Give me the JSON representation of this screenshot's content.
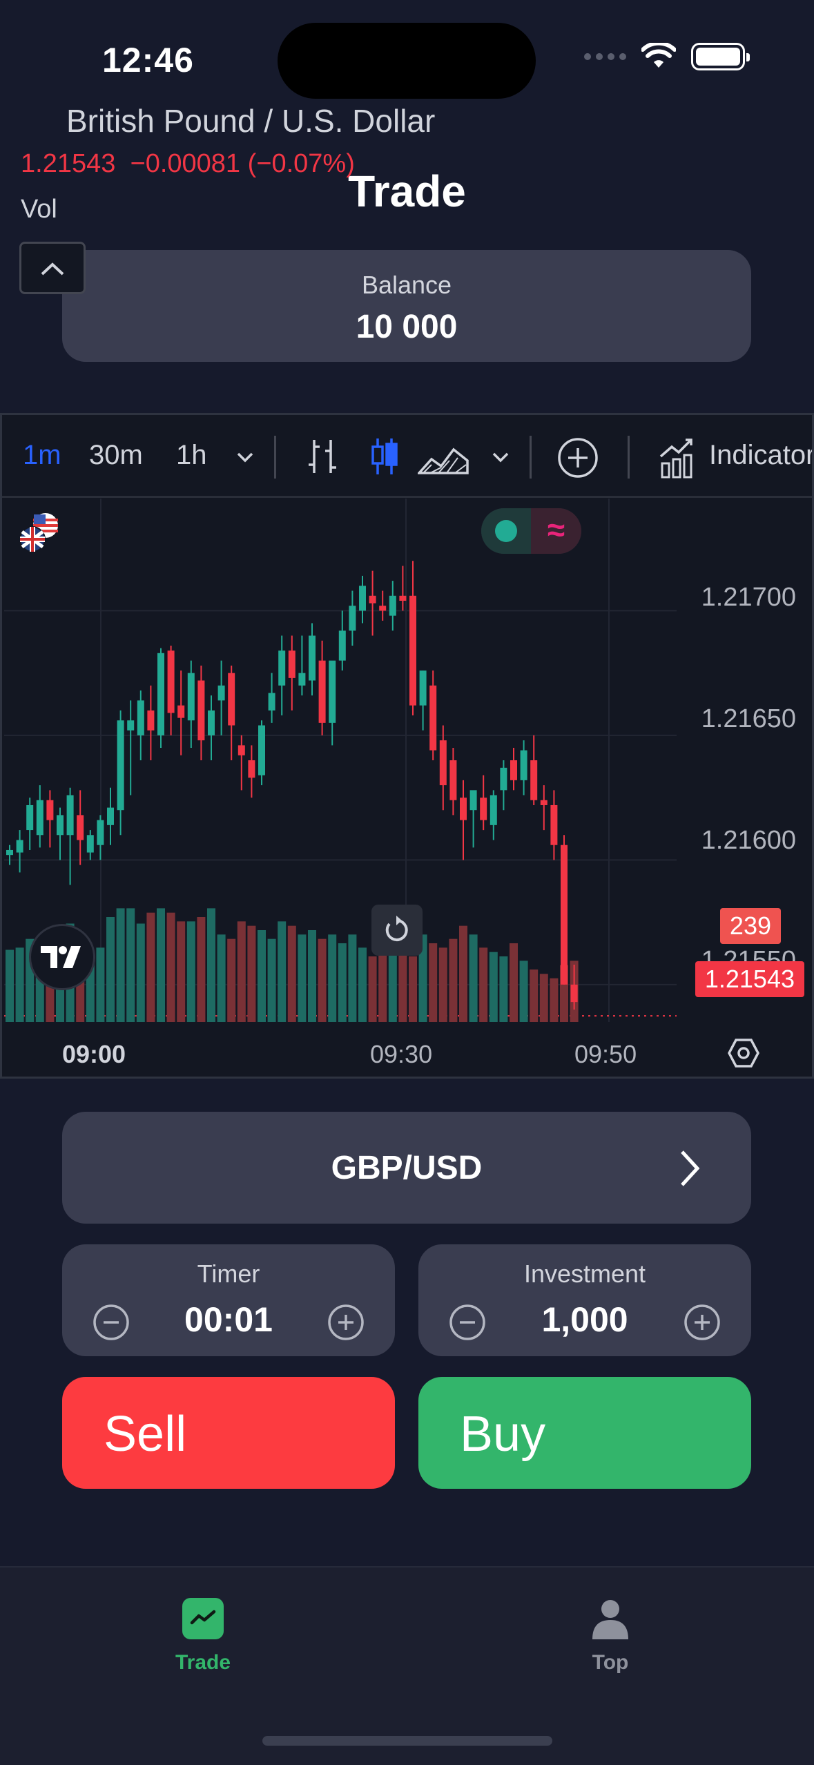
{
  "status_bar": {
    "time": "12:46"
  },
  "page": {
    "title": "Trade"
  },
  "balance": {
    "label": "Balance",
    "value": "10 000"
  },
  "chart_widget": {
    "toolbar": {
      "intervals": [
        "1m",
        "30m",
        "1h"
      ],
      "active_interval": "1m",
      "indicators_label": "Indicators"
    },
    "legend": {
      "symbol_name": "British Pound / U.S. Dollar",
      "last": "1.21543",
      "change": "−0.00081",
      "change_pct": "(−0.07%)",
      "vol_label": "Vol"
    },
    "price_axis": [
      "1.21700",
      "1.21650",
      "1.21600",
      "1.21550"
    ],
    "time_axis": {
      "t1": "09:00",
      "t2": "09:30",
      "t3": "09:50"
    },
    "volume_tag": "239",
    "last_price_tag": "1.21543",
    "colors": {
      "up": "#22ab94",
      "down": "#f23645",
      "accent": "#2962ff"
    }
  },
  "chart_data": {
    "type": "candlestick",
    "title": "British Pound / U.S. Dollar",
    "ylim": [
      1.21535,
      1.21745
    ],
    "y_ticks": [
      1.217,
      1.2165,
      1.216,
      1.2155
    ],
    "x_ticks": [
      "09:00",
      "09:30",
      "09:50"
    ],
    "candles": [
      [
        1.21602,
        1.21606,
        1.21598,
        1.21604
      ],
      [
        1.21603,
        1.21612,
        1.21595,
        1.21608
      ],
      [
        1.21612,
        1.21625,
        1.21604,
        1.21622
      ],
      [
        1.2161,
        1.2163,
        1.21605,
        1.21624
      ],
      [
        1.21624,
        1.21628,
        1.21605,
        1.21616
      ],
      [
        1.2161,
        1.21621,
        1.216,
        1.21618
      ],
      [
        1.2161,
        1.21629,
        1.2159,
        1.21626
      ],
      [
        1.21618,
        1.21628,
        1.21598,
        1.21608
      ],
      [
        1.21603,
        1.21612,
        1.216,
        1.2161
      ],
      [
        1.21606,
        1.21618,
        1.216,
        1.21616
      ],
      [
        1.21614,
        1.21629,
        1.21606,
        1.21621
      ],
      [
        1.2162,
        1.2166,
        1.2161,
        1.21656
      ],
      [
        1.21652,
        1.21664,
        1.21626,
        1.21656
      ],
      [
        1.2165,
        1.21668,
        1.2164,
        1.21664
      ],
      [
        1.2166,
        1.2167,
        1.2164,
        1.21652
      ],
      [
        1.2165,
        1.21685,
        1.21645,
        1.21683
      ],
      [
        1.21684,
        1.21686,
        1.2165,
        1.21659
      ],
      [
        1.21662,
        1.21676,
        1.21642,
        1.21657
      ],
      [
        1.21656,
        1.2168,
        1.21645,
        1.21675
      ],
      [
        1.21672,
        1.21678,
        1.2164,
        1.21648
      ],
      [
        1.2165,
        1.21666,
        1.2164,
        1.2166
      ],
      [
        1.21664,
        1.2168,
        1.2165,
        1.2167
      ],
      [
        1.21675,
        1.21678,
        1.2164,
        1.21654
      ],
      [
        1.21646,
        1.2165,
        1.21628,
        1.21642
      ],
      [
        1.2164,
        1.21646,
        1.21625,
        1.21633
      ],
      [
        1.21634,
        1.21656,
        1.2163,
        1.21654
      ],
      [
        1.2166,
        1.21675,
        1.21655,
        1.21667
      ],
      [
        1.2167,
        1.2169,
        1.21658,
        1.21684
      ],
      [
        1.21684,
        1.2169,
        1.2166,
        1.21673
      ],
      [
        1.2167,
        1.2169,
        1.21666,
        1.21675
      ],
      [
        1.21672,
        1.21695,
        1.21666,
        1.2169
      ],
      [
        1.2168,
        1.21688,
        1.2165,
        1.21655
      ],
      [
        1.21655,
        1.21676,
        1.21646,
        1.2168
      ],
      [
        1.2168,
        1.217,
        1.21676,
        1.21692
      ],
      [
        1.21692,
        1.21708,
        1.21686,
        1.21702
      ],
      [
        1.217,
        1.21714,
        1.21695,
        1.2171
      ],
      [
        1.21706,
        1.21716,
        1.2169,
        1.21703
      ],
      [
        1.21702,
        1.21708,
        1.21696,
        1.217
      ],
      [
        1.21698,
        1.21712,
        1.21692,
        1.21706
      ],
      [
        1.21706,
        1.21718,
        1.217,
        1.21704
      ],
      [
        1.21706,
        1.2172,
        1.21658,
        1.21662
      ],
      [
        1.21662,
        1.21676,
        1.21652,
        1.21676
      ],
      [
        1.2167,
        1.21676,
        1.2164,
        1.21644
      ],
      [
        1.21648,
        1.21654,
        1.2162,
        1.2163
      ],
      [
        1.2164,
        1.21645,
        1.21618,
        1.21624
      ],
      [
        1.21625,
        1.21632,
        1.216,
        1.21616
      ],
      [
        1.2162,
        1.21626,
        1.21605,
        1.21628
      ],
      [
        1.21625,
        1.21634,
        1.21612,
        1.21616
      ],
      [
        1.21614,
        1.21628,
        1.21608,
        1.21626
      ],
      [
        1.21628,
        1.2164,
        1.2162,
        1.21637
      ],
      [
        1.2164,
        1.21645,
        1.21628,
        1.21632
      ],
      [
        1.21632,
        1.21648,
        1.21626,
        1.21644
      ],
      [
        1.2164,
        1.2165,
        1.21622,
        1.21624
      ],
      [
        1.21624,
        1.2163,
        1.21612,
        1.21622
      ],
      [
        1.21622,
        1.21628,
        1.216,
        1.21606
      ],
      [
        1.21606,
        1.2161,
        1.2155,
        1.2155
      ],
      [
        1.2155,
        1.21558,
        1.2154,
        1.21543
      ]
    ],
    "volume": [
      33,
      34,
      38,
      32,
      30,
      42,
      45,
      32,
      30,
      34,
      48,
      52,
      52,
      45,
      50,
      52,
      50,
      46,
      46,
      48,
      52,
      40,
      38,
      46,
      44,
      42,
      38,
      46,
      44,
      40,
      42,
      38,
      40,
      36,
      40,
      34,
      30,
      35,
      38,
      40,
      30,
      40,
      36,
      34,
      38,
      44,
      40,
      34,
      32,
      30,
      36,
      28,
      24,
      22,
      20,
      26,
      28
    ],
    "volume_last": 239
  },
  "pair": {
    "label": "GBP/USD"
  },
  "timer": {
    "label": "Timer",
    "value": "00:01"
  },
  "investment": {
    "label": "Investment",
    "value": "1,000"
  },
  "actions": {
    "sell": "Sell",
    "buy": "Buy"
  },
  "tabs": [
    {
      "label": "Trade",
      "active": true
    },
    {
      "label": "Top",
      "active": false
    }
  ]
}
